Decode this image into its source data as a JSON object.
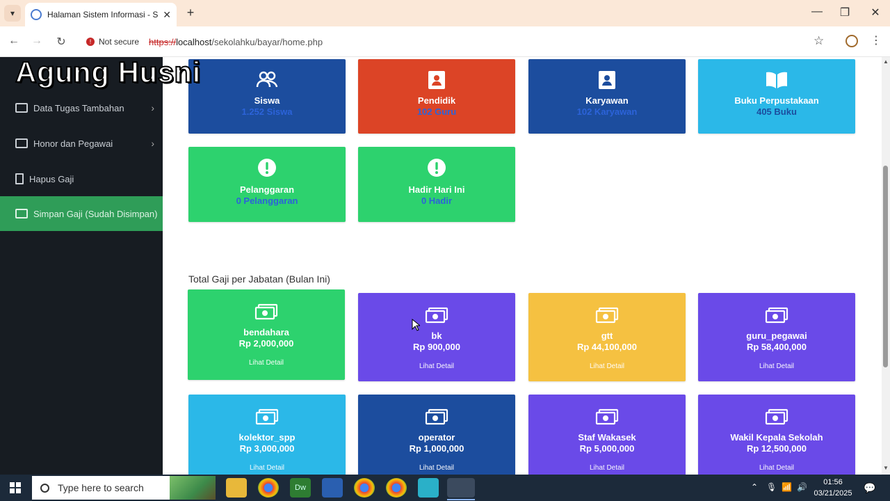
{
  "browser": {
    "tab_title": "Halaman Sistem Informasi - SMK",
    "not_secure": "Not secure",
    "url_scheme": "https://",
    "url_host": "localhost",
    "url_path": "/sekolahku/bayar/home.php"
  },
  "watermark": "Agung Husni",
  "sidebar": {
    "items": [
      {
        "label": "Data Tugas Tambahan"
      },
      {
        "label": "Honor dan Pegawai"
      },
      {
        "label": "Hapus Gaji"
      },
      {
        "label": "Simpan Gaji (Sudah Disimpan)"
      }
    ]
  },
  "stats": [
    {
      "label": "Siswa",
      "value": "1.252 Siswa",
      "color": "#1c4d9e",
      "icon": "users-icon"
    },
    {
      "label": "Pendidik",
      "value": "102 Guru",
      "color": "#dc4426",
      "icon": "id-card-icon"
    },
    {
      "label": "Karyawan",
      "value": "102 Karyawan",
      "color": "#1c4d9e",
      "icon": "id-card-icon"
    },
    {
      "label": "Buku Perpustakaan",
      "value": "405 Buku",
      "color": "#2bb8e8",
      "icon": "book-icon"
    },
    {
      "label": "Pelanggaran",
      "value": "0 Pelanggaran",
      "color": "#2dd26e",
      "icon": "alert-icon"
    },
    {
      "label": "Hadir Hari Ini",
      "value": "0 Hadir",
      "color": "#2dd26e",
      "icon": "alert-icon"
    }
  ],
  "section_title": "Total Gaji per Jabatan (Bulan Ini)",
  "salary_cards": [
    {
      "label": "bendahara",
      "value": "Rp 2,000,000",
      "detail": "Lihat Detail",
      "color": "#2dd26e"
    },
    {
      "label": "bk",
      "value": "Rp 900,000",
      "detail": "Lihat Detail",
      "color": "#6a4ae8"
    },
    {
      "label": "gtt",
      "value": "Rp 44,100,000",
      "detail": "Lihat Detail",
      "color": "#f5c141"
    },
    {
      "label": "guru_pegawai",
      "value": "Rp 58,400,000",
      "detail": "Lihat Detail",
      "color": "#6a4ae8"
    },
    {
      "label": "kolektor_spp",
      "value": "Rp 3,000,000",
      "detail": "Lihat Detail",
      "color": "#2bb8e8"
    },
    {
      "label": "operator",
      "value": "Rp 1,000,000",
      "detail": "Lihat Detail",
      "color": "#1c4d9e"
    },
    {
      "label": "Staf Wakasek",
      "value": "Rp 5,000,000",
      "detail": "Lihat Detail",
      "color": "#6a4ae8"
    },
    {
      "label": "Wakil Kepala Sekolah",
      "value": "Rp 12,500,000",
      "detail": "Lihat Detail",
      "color": "#6a4ae8"
    }
  ],
  "taskbar": {
    "search_placeholder": "Type here to search",
    "time": "01:56",
    "date": "03/21/2025"
  }
}
